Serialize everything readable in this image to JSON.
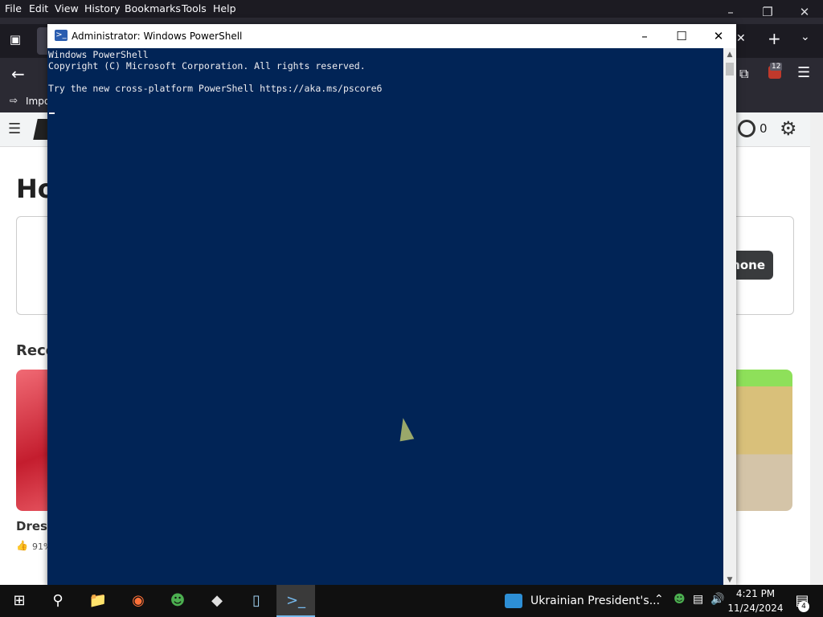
{
  "firefox": {
    "menus": [
      "File",
      "Edit",
      "View",
      "History",
      "Bookmarks",
      "Tools",
      "Help"
    ],
    "bookmark_label": "Impo",
    "extension_badge": "12",
    "robux_count": "0",
    "page": {
      "heading_fragment": "Ho",
      "section_fragment": "Reco",
      "phone_button_fragment": "hone",
      "game_title_fragment": "Dress",
      "rating_fragment": "91%"
    }
  },
  "powershell": {
    "title": "Administrator: Windows PowerShell",
    "lines": [
      "Windows PowerShell",
      "Copyright (C) Microsoft Corporation. All rights reserved.",
      "",
      "Try the new cross-platform PowerShell https://aka.ms/pscore6"
    ]
  },
  "taskbar": {
    "news_text": "Ukrainian President's...",
    "time": "4:21 PM",
    "date": "11/24/2024",
    "notification_count": "4",
    "apps": [
      "start-icon",
      "search-icon",
      "file-explorer-icon",
      "firefox-icon",
      "people-icon",
      "roblox-icon",
      "notepad-icon",
      "powershell-icon"
    ]
  },
  "colors": {
    "console_bg": "#012456",
    "console_fg": "#eeedf0",
    "taskbar_bg": "#101010",
    "firefox_chrome": "#1c1b22"
  }
}
